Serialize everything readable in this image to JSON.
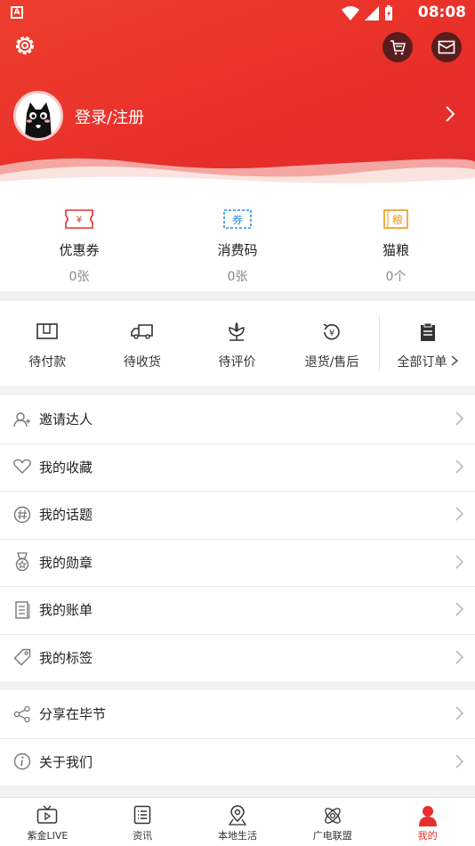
{
  "status_bar": {
    "time": "08:08",
    "app_badge": "A"
  },
  "profile": {
    "login_label": "登录/注册"
  },
  "stats": [
    {
      "label": "优惠券",
      "value": "0张",
      "icon": "coupon-icon",
      "icon_text": "¥",
      "color": "#e8302a"
    },
    {
      "label": "消费码",
      "value": "0张",
      "icon": "voucher-icon",
      "icon_text": "券",
      "color": "#2f8ee8"
    },
    {
      "label": "猫粮",
      "value": "0个",
      "icon": "cat-food-icon",
      "icon_text": "粮",
      "color": "#f09a1a"
    }
  ],
  "orders": [
    {
      "label": "待付款",
      "icon": "wallet-icon"
    },
    {
      "label": "待收货",
      "icon": "truck-icon"
    },
    {
      "label": "待评价",
      "icon": "flower-icon"
    },
    {
      "label": "退货/售后",
      "icon": "refund-icon"
    },
    {
      "label": "全部订单",
      "icon": "clipboard-icon"
    }
  ],
  "menu_a": [
    {
      "label": "邀请达人",
      "icon": "invite-user-icon"
    },
    {
      "label": "我的收藏",
      "icon": "heart-icon"
    },
    {
      "label": "我的话题",
      "icon": "hashtag-icon"
    },
    {
      "label": "我的勋章",
      "icon": "medal-icon"
    },
    {
      "label": "我的账单",
      "icon": "bill-icon"
    },
    {
      "label": "我的标签",
      "icon": "tag-icon"
    }
  ],
  "menu_b": [
    {
      "label": "分享在毕节",
      "icon": "share-icon"
    },
    {
      "label": "关于我们",
      "icon": "info-icon"
    }
  ],
  "tabs": [
    {
      "label": "紫金LIVE",
      "icon": "tv-icon",
      "active": false
    },
    {
      "label": "资讯",
      "icon": "news-icon",
      "active": false
    },
    {
      "label": "本地生活",
      "icon": "location-icon",
      "active": false
    },
    {
      "label": "广电联盟",
      "icon": "atom-icon",
      "active": false
    },
    {
      "label": "我的",
      "icon": "user-icon",
      "active": true
    }
  ],
  "colors": {
    "accent": "#e8302a",
    "header_red": "#ea3a2c"
  }
}
